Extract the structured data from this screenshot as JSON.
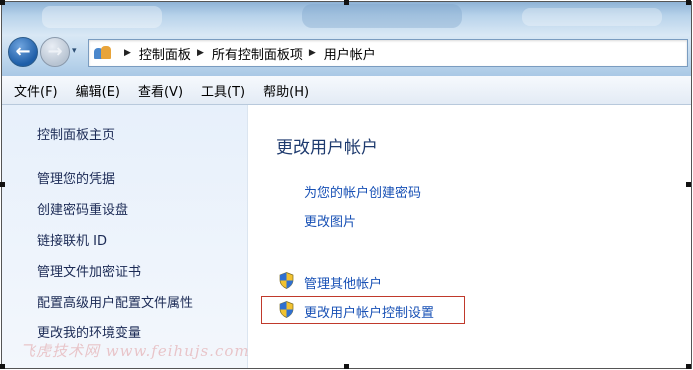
{
  "nav": {
    "back_icon": "back-arrow-icon",
    "forward_icon": "forward-arrow-icon",
    "back_glyph": "←",
    "forward_glyph": "→",
    "history_glyph": "▾"
  },
  "address": {
    "icon": "control-panel-icon",
    "separator": "▶",
    "breadcrumbs": [
      "控制面板",
      "所有控制面板项",
      "用户帐户"
    ]
  },
  "menu": [
    "文件(F)",
    "编辑(E)",
    "查看(V)",
    "工具(T)",
    "帮助(H)"
  ],
  "sidebar": {
    "home": "控制面板主页",
    "items": [
      "管理您的凭据",
      "创建密码重设盘",
      "链接联机 ID",
      "管理文件加密证书",
      "配置高级用户配置文件属性",
      "更改我的环境变量"
    ]
  },
  "main": {
    "title": "更改用户帐户",
    "links": [
      "为您的帐户创建密码",
      "更改图片"
    ],
    "shield_links": [
      "管理其他帐户",
      "更改用户帐户控制设置"
    ]
  },
  "watermark": "飞虎技术网 www.feihujs.com",
  "colors": {
    "link": "#1750b5",
    "title": "#1e3a6e",
    "highlight": "#c0392b"
  }
}
